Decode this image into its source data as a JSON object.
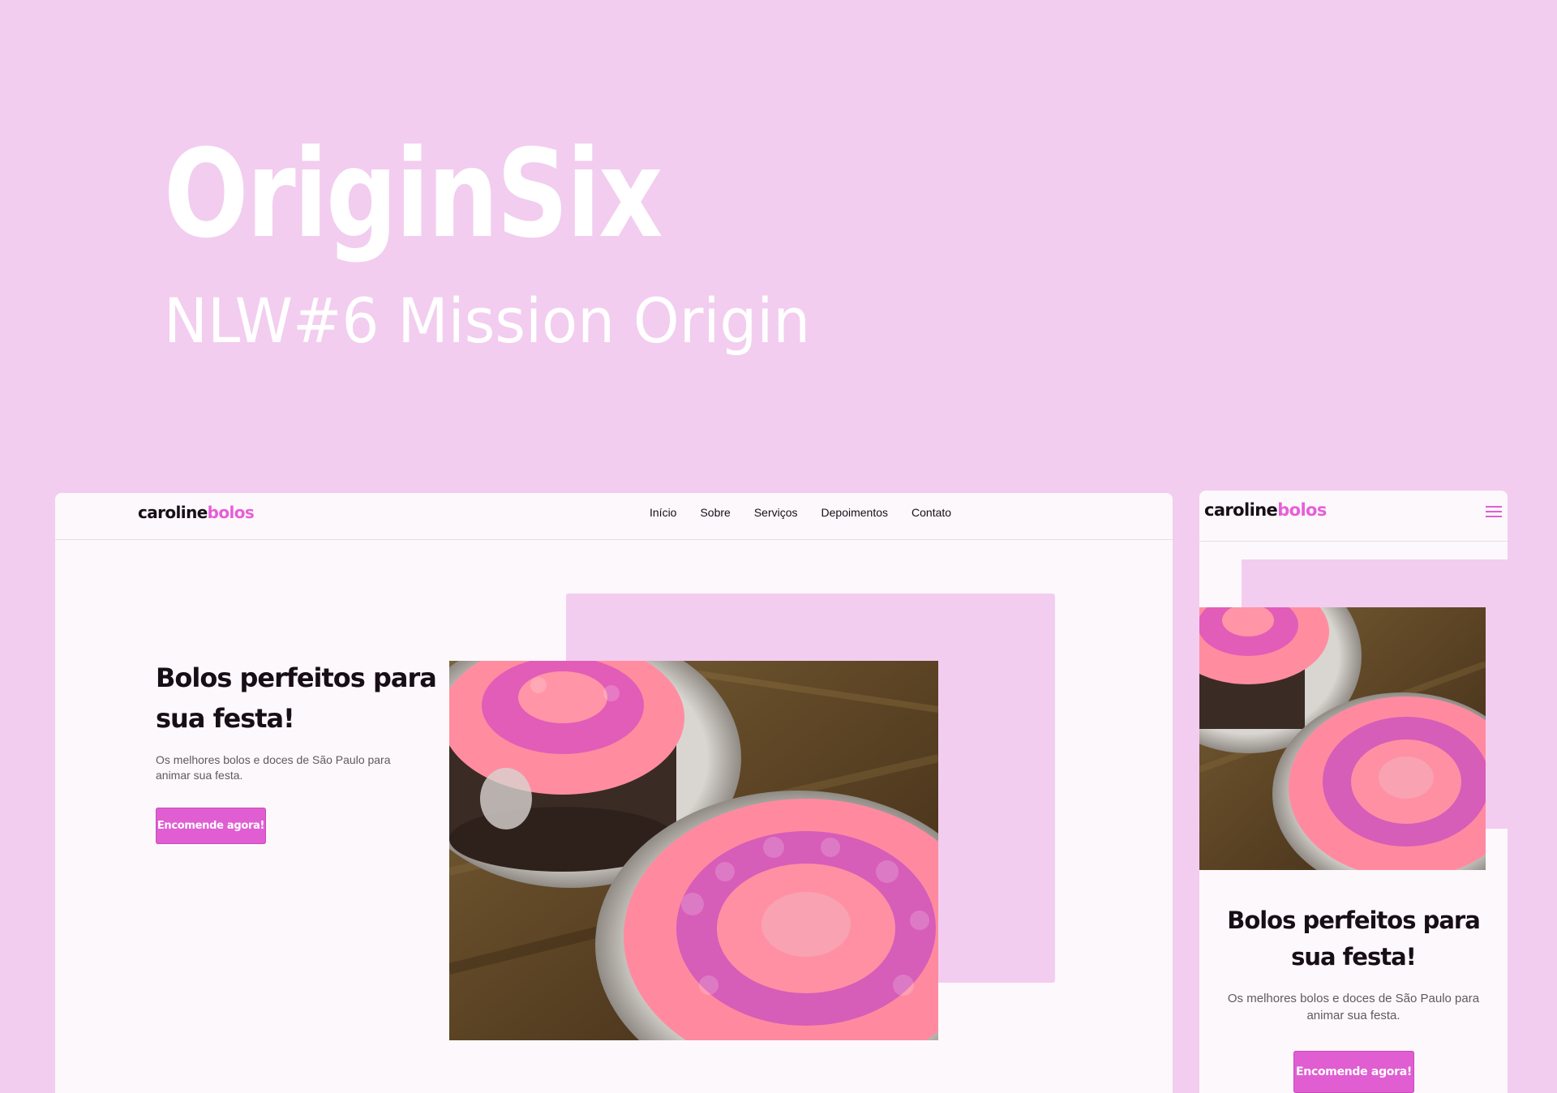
{
  "banner": {
    "title": "OriginSix",
    "subtitle": "NLW#6 Mission Origin"
  },
  "desktop": {
    "logo_part1": "caroline",
    "logo_part2": "bolos",
    "nav": [
      "Início",
      "Sobre",
      "Serviços",
      "Depoimentos",
      "Contato"
    ],
    "headline": "Bolos perfeitos para sua festa!",
    "description": "Os melhores bolos e doces de São Paulo para animar sua festa.",
    "cta_label": "Encomende agora!"
  },
  "mobile": {
    "logo_part1": "caroline",
    "logo_part2": "bolos",
    "headline": "Bolos perfeitos para sua festa!",
    "description": "Os melhores bolos e doces de São Paulo para animar sua festa.",
    "cta_label": "Encomende agora!",
    "menu_icon": "hamburger-menu-icon"
  },
  "colors": {
    "background": "#f2cdef",
    "accent": "#e05ed2",
    "logo_accent": "#e75fd6",
    "text_dark": "#170e16",
    "page_bg": "#fdf8fc"
  }
}
